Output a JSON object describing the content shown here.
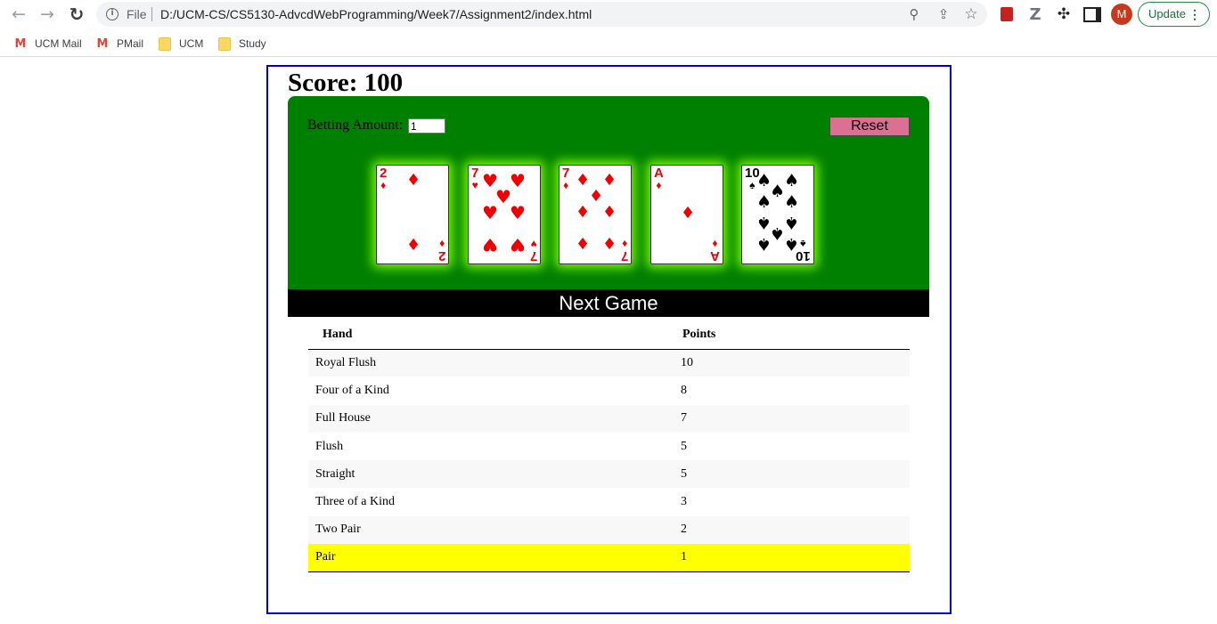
{
  "browser": {
    "file_label": "File",
    "url": "D:/UCM-CS/CS5130-AdvcdWebProgramming/Week7/Assignment2/index.html",
    "avatar_letter": "M",
    "update_label": "Update",
    "bookmarks": [
      {
        "label": "UCM Mail",
        "icon": "gmail-icon"
      },
      {
        "label": "PMail",
        "icon": "gmail-icon"
      },
      {
        "label": "UCM",
        "icon": "folder-icon"
      },
      {
        "label": "Study",
        "icon": "folder-icon"
      }
    ]
  },
  "game": {
    "score_text": "Score: 100",
    "bet_label": "Betting Amount:",
    "bet_value": "1",
    "reset_label": "Reset",
    "next_game_label": "Next Game",
    "cards": [
      {
        "rank": "2",
        "suit": "♦",
        "color": "red"
      },
      {
        "rank": "7",
        "suit": "♥",
        "color": "red"
      },
      {
        "rank": "7",
        "suit": "♦",
        "color": "red"
      },
      {
        "rank": "A",
        "suit": "♦",
        "color": "red"
      },
      {
        "rank": "10",
        "suit": "♠",
        "color": "black"
      }
    ]
  },
  "payout_table": {
    "headers": {
      "hand": "Hand",
      "points": "Points"
    },
    "rows": [
      {
        "hand": "Royal Flush",
        "points": "10"
      },
      {
        "hand": "Four of a Kind",
        "points": "8"
      },
      {
        "hand": "Full House",
        "points": "7"
      },
      {
        "hand": "Flush",
        "points": "5"
      },
      {
        "hand": "Straight",
        "points": "5"
      },
      {
        "hand": "Three of a Kind",
        "points": "3"
      },
      {
        "hand": "Two Pair",
        "points": "2"
      },
      {
        "hand": "Pair",
        "points": "1"
      }
    ],
    "highlighted_hand": "Pair",
    "highlight_color": "#ffff00"
  },
  "colors": {
    "felt": "#008000",
    "frame_border": "#0000cc",
    "reset_button": "#db7093",
    "card_glow": "#7cfc00"
  }
}
